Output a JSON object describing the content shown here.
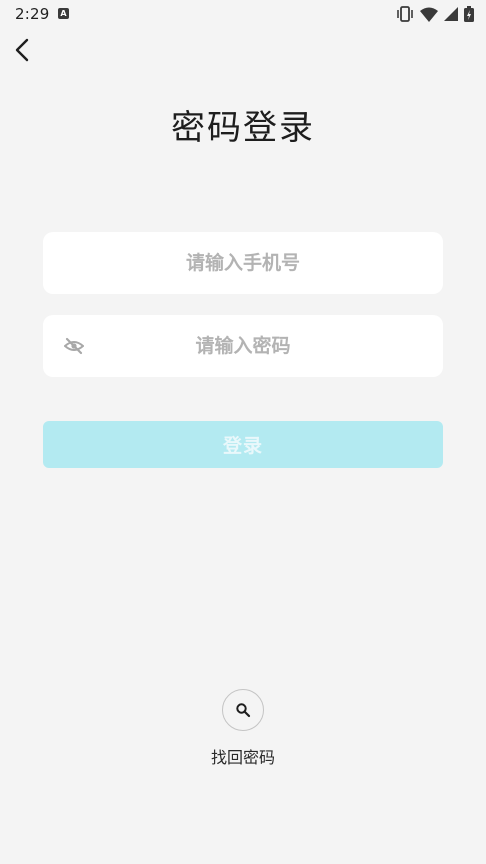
{
  "status_bar": {
    "time": "2:29",
    "notification_icon_letter": "A"
  },
  "header": {
    "title": "密码登录"
  },
  "form": {
    "phone_placeholder": "请输入手机号",
    "phone_value": "",
    "password_placeholder": "请输入密码",
    "password_value": "",
    "login_label": "登录"
  },
  "footer": {
    "find_password_label": "找回密码"
  },
  "colors": {
    "background": "#f4f4f4",
    "login_button_disabled": "#b3eaf1",
    "placeholder": "#b3b3b3"
  }
}
